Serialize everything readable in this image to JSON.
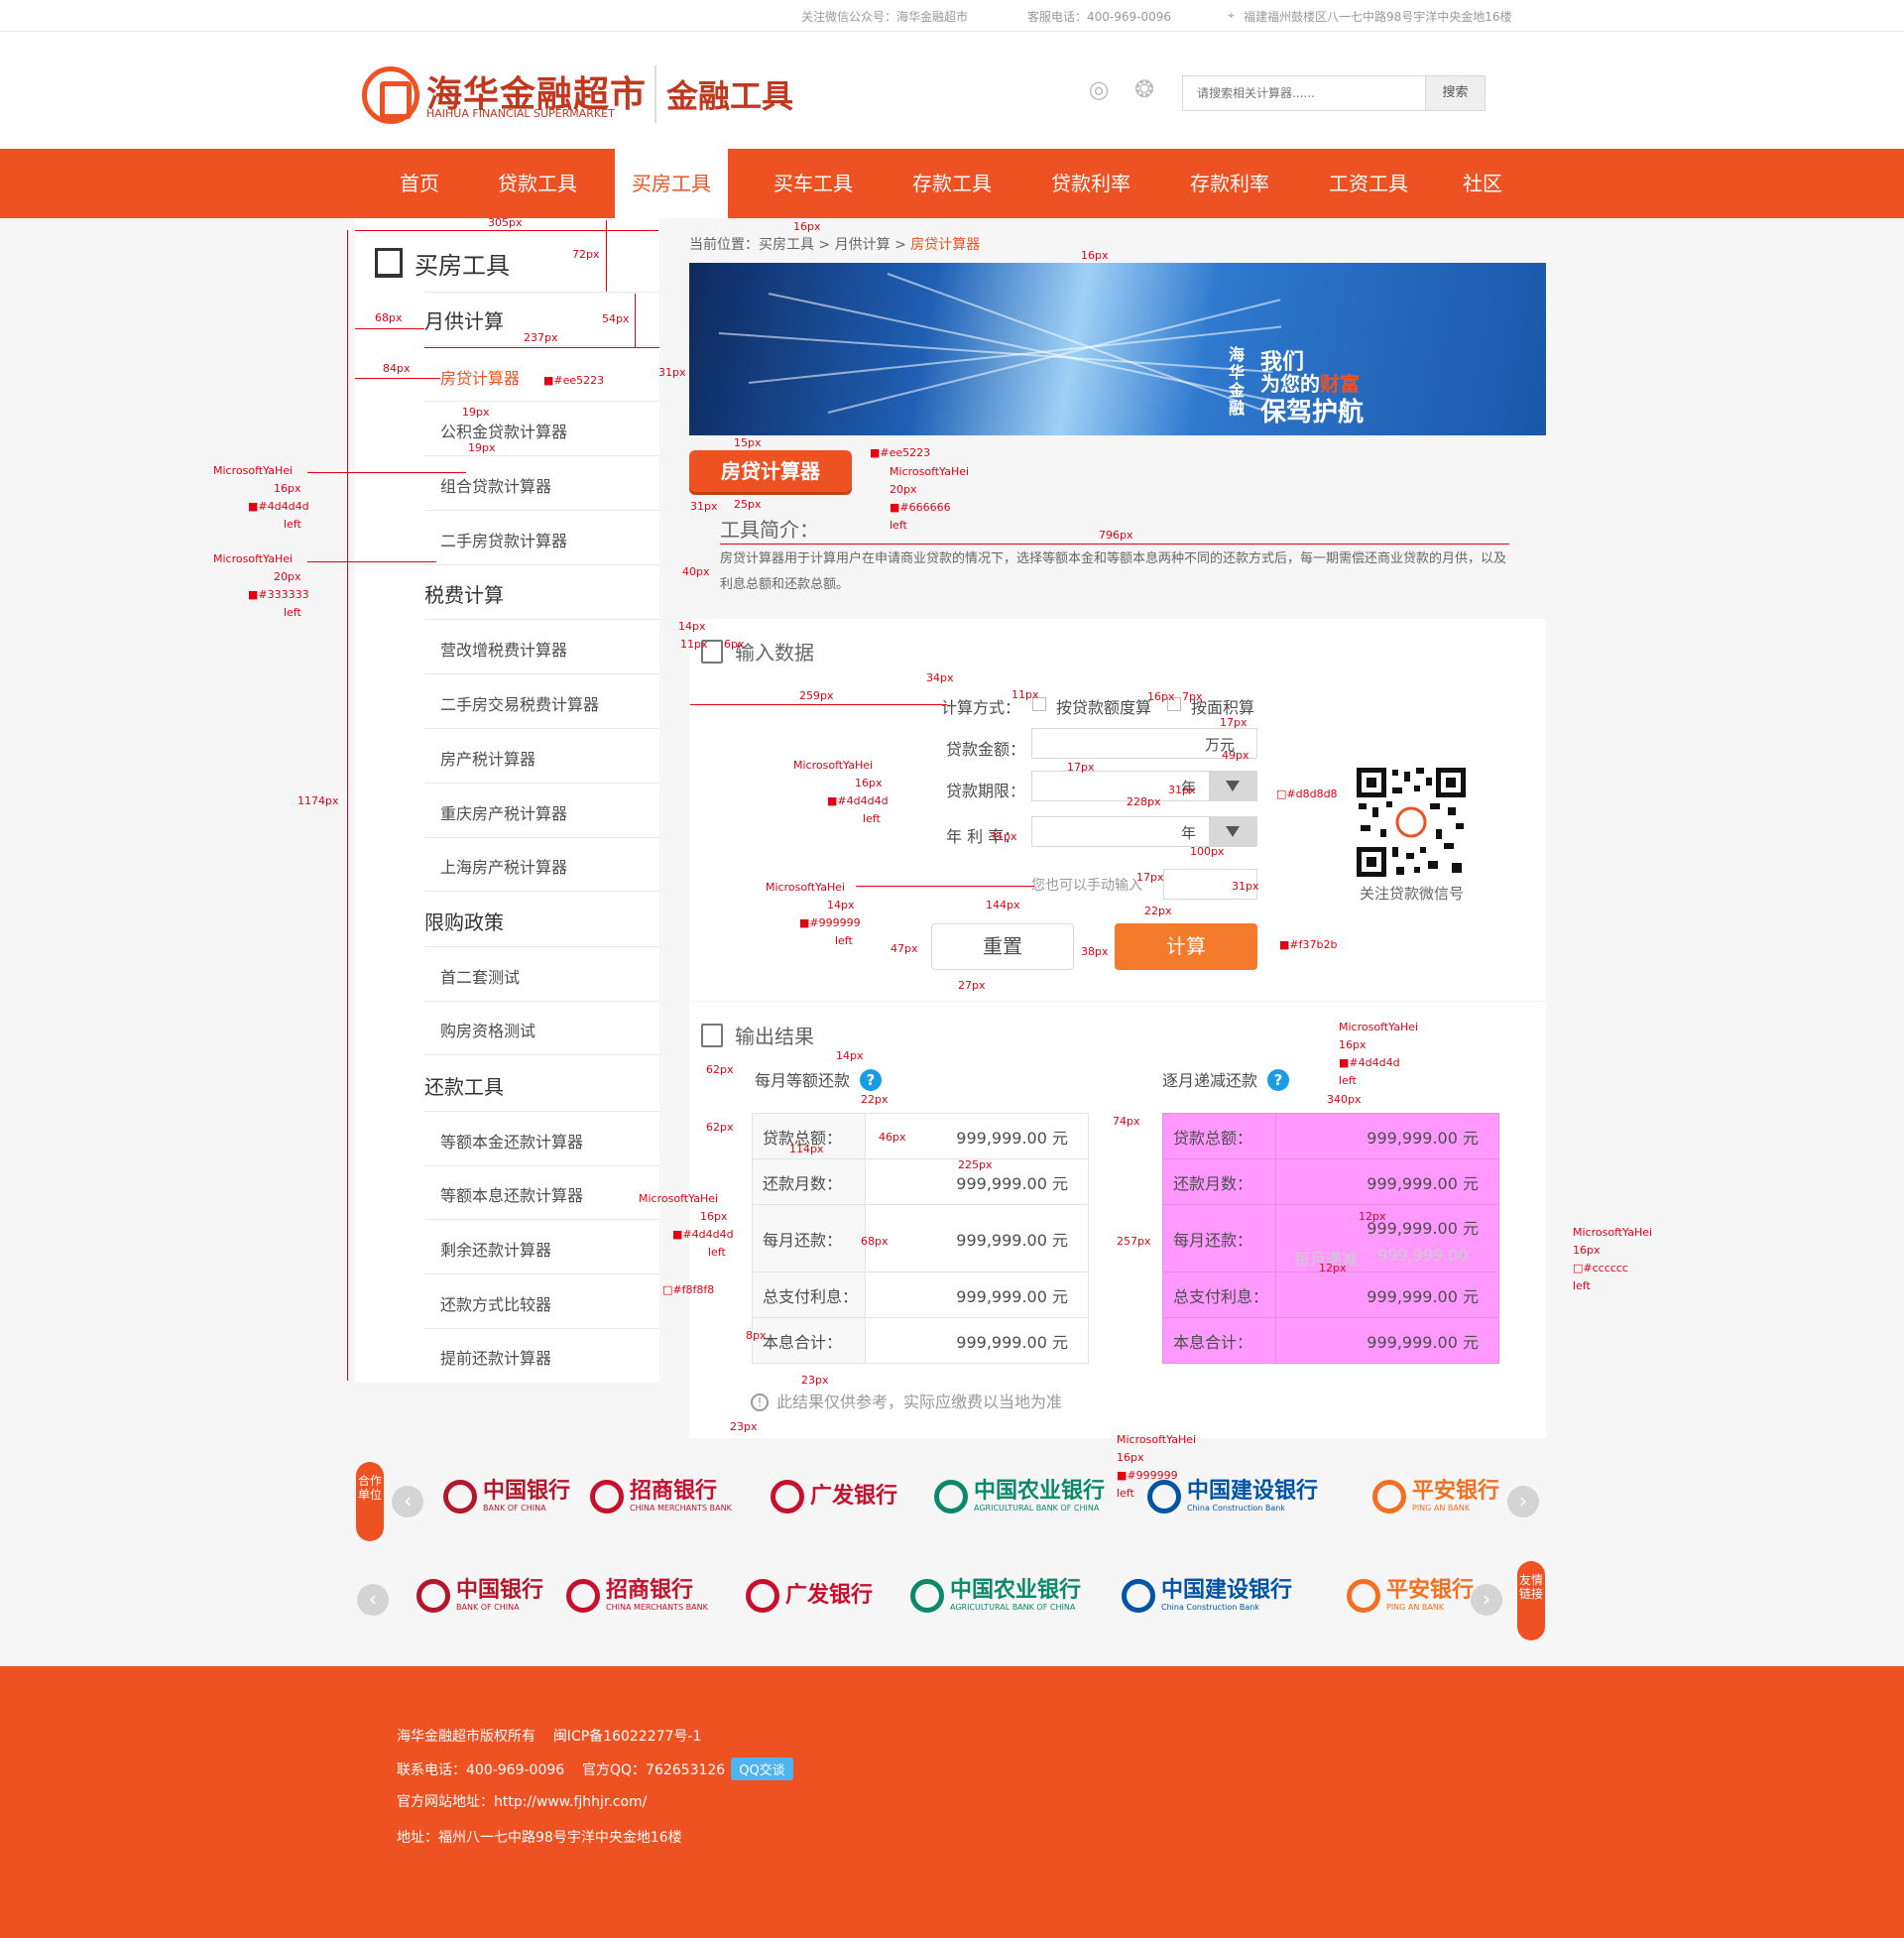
{
  "topbar": {
    "wechat": "关注微信公众号：海华金融超市",
    "phone": "客服电话：400-969-0096",
    "address": "福建福州鼓楼区八一七中路98号宇洋中央金地16楼"
  },
  "header": {
    "logo_cn": "海华金融超市",
    "logo_en": "HAIHUA FINANCIAL SUPERMARKET",
    "logo_sub": "金融工具",
    "search_placeholder": "请搜索相关计算器......",
    "search_button": "搜索"
  },
  "nav": [
    "首页",
    "贷款工具",
    "买房工具",
    "买车工具",
    "存款工具",
    "贷款利率",
    "存款利率",
    "工资工具",
    "社区"
  ],
  "sidebar": {
    "title": "买房工具",
    "groups": [
      {
        "title": "月供计算",
        "items": [
          "房贷计算器",
          "公积金贷款计算器",
          "组合贷款计算器",
          "二手房贷款计算器"
        ]
      },
      {
        "title": "税费计算",
        "items": [
          "营改增税费计算器",
          "二手房交易税费计算器",
          "房产税计算器",
          "重庆房产税计算器",
          "上海房产税计算器"
        ]
      },
      {
        "title": "限购政策",
        "items": [
          "首二套测试",
          "购房资格测试"
        ]
      },
      {
        "title": "还款工具",
        "items": [
          "等额本金还款计算器",
          "等额本息还款计算器",
          "剩余还款计算器",
          "还款方式比较器",
          "提前还款计算器"
        ]
      }
    ]
  },
  "breadcrumb": {
    "prefix": "当前位置：买房工具 > 月供计算 > ",
    "current": "房贷计算器"
  },
  "banner": {
    "vertical": "海华金融",
    "line1": "我们",
    "line2_pre": "为您的",
    "line2_em": "财富",
    "line3": "保驾护航"
  },
  "calc_tag": "房贷计算器",
  "intro": {
    "title": "工具简介：",
    "text": "房贷计算器用于计算用户在申请商业贷款的情况下，选择等额本金和等额本息两种不同的还款方式后，每一期需偿还商业贷款的月供，以及利息总额和还款总额。"
  },
  "input": {
    "title": "输入数据",
    "method_label": "计算方式：",
    "method_options": [
      "按贷款额度算",
      "按面积算"
    ],
    "amount_label": "贷款金额：",
    "amount_unit": "万元",
    "term_label": "贷款期限：",
    "term_unit": "年",
    "rate_label": "年 利 率：",
    "rate_unit": "年",
    "hint": "您也可以手动输入",
    "reset": "重置",
    "calc": "计算",
    "qr_caption": "关注贷款微信号"
  },
  "output": {
    "title": "输出结果",
    "left_title": "每月等额还款",
    "right_title": "逐月递减还款",
    "help": "?",
    "rows": [
      {
        "k": "贷款总额：",
        "v": "999,999.00 元"
      },
      {
        "k": "还款月数：",
        "v": "999,999.00 元"
      },
      {
        "k": "每月还款：",
        "v": "999,999.00 元"
      },
      {
        "k": "总支付利息：",
        "v": "999,999.00 元"
      },
      {
        "k": "本息合计：",
        "v": "999,999.00 元"
      }
    ],
    "ghost_label": "每月递减",
    "ghost_value": "999,999.00",
    "note": "此结果仅供参考，实际应缴费以当地为准"
  },
  "partners": {
    "tag1": "合作单位",
    "tag2": "友情链接",
    "banks": [
      {
        "cn": "中国银行",
        "en": "BANK OF CHINA",
        "color": "#b4162b"
      },
      {
        "cn": "招商银行",
        "en": "CHINA MERCHANTS BANK",
        "color": "#c8102e"
      },
      {
        "cn": "广发银行",
        "en": "",
        "color": "#c8102e"
      },
      {
        "cn": "中国农业银行",
        "en": "AGRICULTURAL BANK OF CHINA",
        "color": "#0a8a6a"
      },
      {
        "cn": "中国建设银行",
        "en": "China Construction Bank",
        "color": "#0054a6"
      },
      {
        "cn": "平安银行",
        "en": "PING AN BANK",
        "color": "#f36f21"
      }
    ]
  },
  "footer": {
    "copyright": "海华金融超市版权所有",
    "icp": "闽ICP备16022277号-1",
    "phone": "联系电话：400-969-0096",
    "qq": "官方QQ：762653126",
    "qq_btn": "QQ交谈",
    "site": "官方网站地址：http://www.fjhhjr.com/",
    "address": "地址：福州八一七中路98号宇洋中央金地16楼"
  },
  "annotations": {
    "font": "MicrosoftYaHei",
    "c_ee5223": "■#ee5223",
    "c_4d4d4d": "■#4d4d4d",
    "c_333333": "■#333333",
    "c_666666": "■#666666",
    "c_999999": "■#999999",
    "c_d8d8d8": "□#d8d8d8",
    "c_f37b2b": "■#f37b2b",
    "c_f8f8f8": "□#f8f8f8",
    "c_cccccc": "□#cccccc",
    "left": "left",
    "px14": "14px",
    "px16": "16px",
    "px20": "20px",
    "m305": "305px",
    "m72": "72px",
    "m68": "68px",
    "m237": "237px",
    "m54": "54px",
    "m84": "84px",
    "m19": "19px",
    "m31": "31px",
    "m1174": "1174px",
    "m15": "15px",
    "m25": "25px",
    "m40": "40px",
    "m796": "796px",
    "m34": "34px",
    "m11": "11px",
    "m259": "259px",
    "m7": "7px",
    "m17": "17px",
    "m49": "49px",
    "m228": "228px",
    "m100": "100px",
    "m144": "144px",
    "m22": "22px",
    "m47": "47px",
    "m38": "38px",
    "m27": "27px",
    "m62": "62px",
    "m46": "46px",
    "m114": "114px",
    "m225": "225px",
    "m340": "340px",
    "m74": "74px",
    "m257": "257px",
    "m12": "12px",
    "m68b": "68px",
    "m8": "8px",
    "m23": "23px",
    "m6": "6px"
  }
}
